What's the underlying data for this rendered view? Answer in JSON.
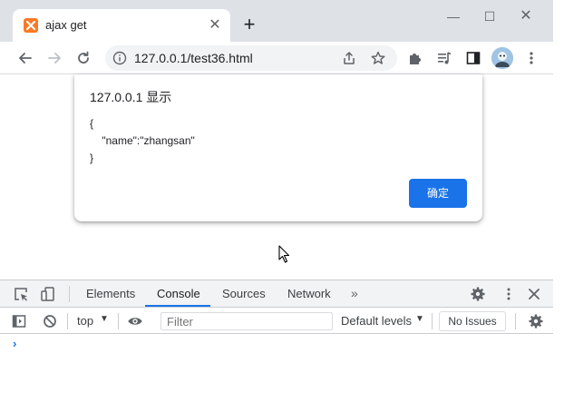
{
  "browser": {
    "tab_title": "ajax get",
    "tab_close_glyph": "✕",
    "new_tab_glyph": "+",
    "url": "127.0.0.1/test36.html",
    "window_min_glyph": "—",
    "window_max_glyph": "☐",
    "window_close_glyph": "✕"
  },
  "dialog": {
    "title": "127.0.0.1 显示",
    "message": "{\n    \"name\":\"zhangsan\"\n}",
    "ok_label": "确定"
  },
  "devtools": {
    "tabs": [
      {
        "label": "Elements"
      },
      {
        "label": "Console"
      },
      {
        "label": "Sources"
      },
      {
        "label": "Network"
      }
    ],
    "more_glyph": "»",
    "active_tab": "Console",
    "console": {
      "context": "top",
      "caret": "▼",
      "filter_placeholder": "Filter",
      "levels": "Default levels",
      "issues": "No Issues",
      "prompt_glyph": "›"
    }
  },
  "colors": {
    "accent": "#1a73e8",
    "tabstrip": "#dee1e6",
    "favicon": "#fb7a24"
  }
}
